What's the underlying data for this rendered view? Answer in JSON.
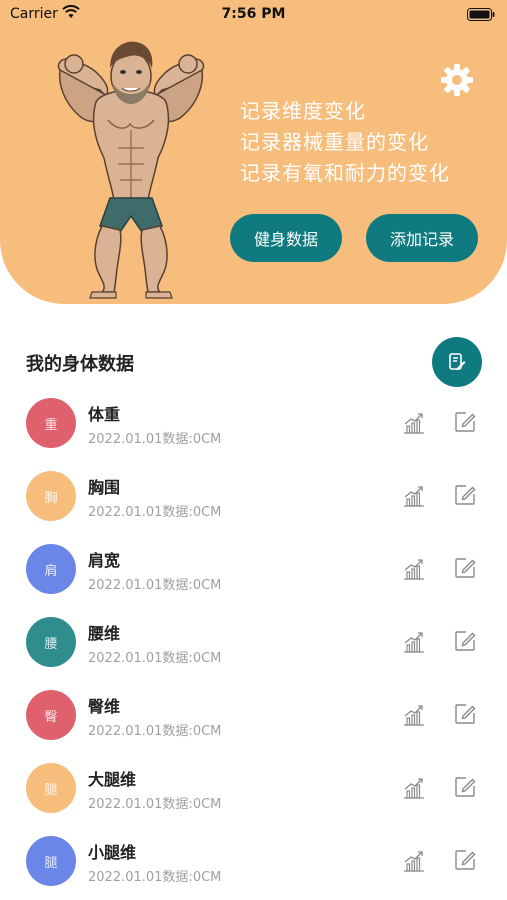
{
  "status_bar": {
    "carrier": "Carrier",
    "time": "7:56 PM"
  },
  "header": {
    "slogans": [
      "记录维度变化",
      "记录器械重量的变化",
      "记录有氧和耐力的变化"
    ],
    "fitness_data_button": "健身数据",
    "add_record_button": "添加记录"
  },
  "section": {
    "title": "我的身体数据"
  },
  "items": [
    {
      "avatar": "重",
      "title": "体重",
      "subtitle": "2022.01.01数据:0CM",
      "color": "#e0616e"
    },
    {
      "avatar": "胸",
      "title": "胸围",
      "subtitle": "2022.01.01数据:0CM",
      "color": "#f7bd7d"
    },
    {
      "avatar": "肩",
      "title": "肩宽",
      "subtitle": "2022.01.01数据:0CM",
      "color": "#6a86e6"
    },
    {
      "avatar": "腰",
      "title": "腰维",
      "subtitle": "2022.01.01数据:0CM",
      "color": "#2f8d8e"
    },
    {
      "avatar": "臀",
      "title": "臀维",
      "subtitle": "2022.01.01数据:0CM",
      "color": "#e0616e"
    },
    {
      "avatar": "腿",
      "title": "大腿维",
      "subtitle": "2022.01.01数据:0CM",
      "color": "#f7bd7d"
    },
    {
      "avatar": "腿",
      "title": "小腿维",
      "subtitle": "2022.01.01数据:0CM",
      "color": "#6a86e6"
    }
  ],
  "colors": {
    "accent": "#0f7b80",
    "header_bg": "#f7bd7d"
  },
  "icons": {
    "settings": "gear-icon",
    "edit_fab": "edit-note-icon",
    "chart": "trend-chart-icon",
    "edit": "edit-icon"
  }
}
